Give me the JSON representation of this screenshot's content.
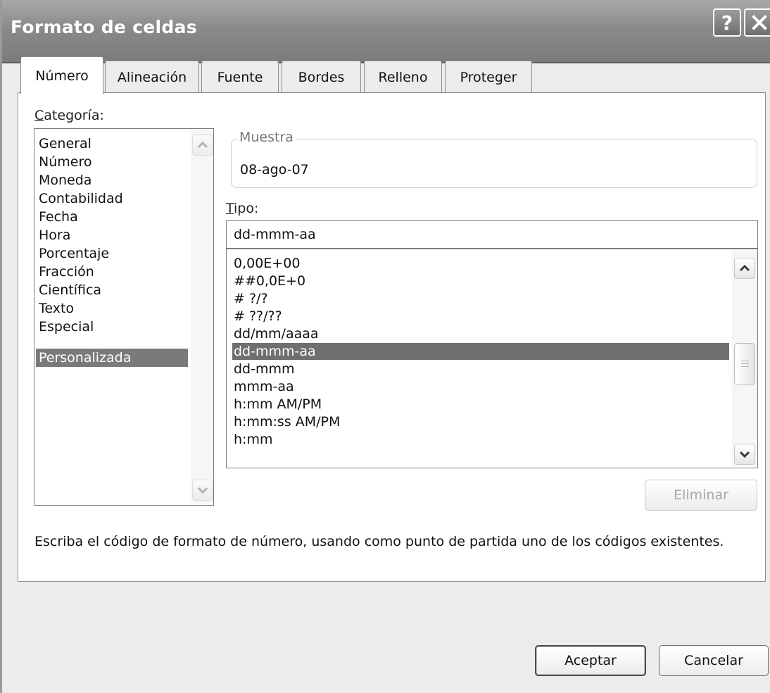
{
  "dialog": {
    "title": "Formato de celdas",
    "help_label": "?",
    "close_icon": "close-icon"
  },
  "tabs": [
    {
      "label": "Número",
      "active": true
    },
    {
      "label": "Alineación",
      "active": false
    },
    {
      "label": "Fuente",
      "active": false
    },
    {
      "label": "Bordes",
      "active": false
    },
    {
      "label": "Relleno",
      "active": false
    },
    {
      "label": "Proteger",
      "active": false
    }
  ],
  "category": {
    "label_accesskey": "C",
    "label_rest": "ategoría:",
    "items": [
      "General",
      "Número",
      "Moneda",
      "Contabilidad",
      "Fecha",
      "Hora",
      "Porcentaje",
      "Fracción",
      "Científica",
      "Texto",
      "Especial",
      "Personalizada"
    ],
    "selected": "Personalizada"
  },
  "sample": {
    "legend": "Muestra",
    "value": "08-ago-07"
  },
  "type": {
    "label_accesskey": "T",
    "label_rest": "ipo:",
    "value": "dd-mmm-aa",
    "items": [
      "0,00E+00",
      "##0,0E+0",
      "# ?/?",
      "# ??/??",
      "dd/mm/aaaa",
      "dd-mmm-aa",
      "dd-mmm",
      "mmm-aa",
      "h:mm AM/PM",
      "h:mm:ss AM/PM",
      "h:mm"
    ],
    "selected": "dd-mmm-aa"
  },
  "delete_button": "Eliminar",
  "description": "Escriba el código de formato de número, usando como punto de partida uno de los códigos existentes.",
  "buttons": {
    "ok": "Aceptar",
    "cancel": "Cancelar"
  },
  "colors": {
    "selection": "#7a7a7a",
    "titlebar": "#8a8a8a"
  }
}
